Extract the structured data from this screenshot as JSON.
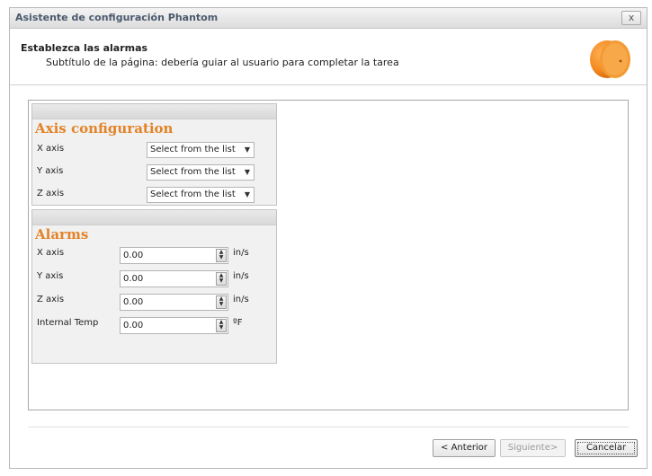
{
  "window": {
    "title": "Asistente de configuración Phantom",
    "close_label": "x"
  },
  "header": {
    "title": "Establezca las alarmas",
    "subtitle": "Subtítulo de la página: debería guiar al usuario para completar la tarea",
    "logo_icon": "phantom-sensor-icon"
  },
  "axis_configuration": {
    "title": "Axis configuration",
    "rows": [
      {
        "label": "X axis",
        "value": "Select from the list"
      },
      {
        "label": "Y axis",
        "value": "Select from the list"
      },
      {
        "label": "Z axis",
        "value": "Select from the list"
      }
    ]
  },
  "alarms": {
    "title": "Alarms",
    "rows": [
      {
        "label": "X axis",
        "value": "0.00",
        "unit": "in/s"
      },
      {
        "label": "Y axis",
        "value": "0.00",
        "unit": "in/s"
      },
      {
        "label": "Z axis",
        "value": "0.00",
        "unit": "in/s"
      },
      {
        "label": "Internal Temp",
        "value": "0.00",
        "unit": "ºF"
      }
    ]
  },
  "footer": {
    "back_label": "< Anterior",
    "next_label": "Siguiente>",
    "cancel_label": "Cancelar"
  },
  "colors": {
    "accent": "#E38327",
    "title_text": "#4A5A6E"
  }
}
